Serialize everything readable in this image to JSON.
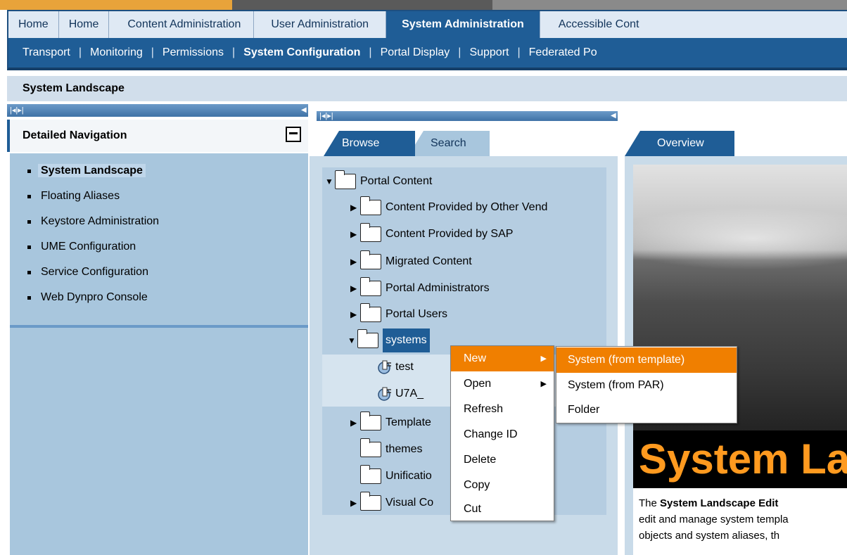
{
  "top_nav": {
    "tabs": [
      {
        "label": "Home"
      },
      {
        "label": "Home"
      },
      {
        "label": "Content Administration"
      },
      {
        "label": "User Administration"
      },
      {
        "label": "System Administration",
        "active": true
      },
      {
        "label": "Accessible Cont"
      }
    ]
  },
  "sub_nav": {
    "items": [
      "Transport",
      "Monitoring",
      "Permissions",
      "System Configuration",
      "Portal Display",
      "Support",
      "Federated Po"
    ],
    "active": "System Configuration",
    "separator": "|"
  },
  "page_title": "System Landscape",
  "left_nav": {
    "title": "Detailed Navigation",
    "items": [
      {
        "label": "System Landscape",
        "active": true
      },
      {
        "label": "Floating Aliases"
      },
      {
        "label": "Keystore Administration"
      },
      {
        "label": "UME Configuration"
      },
      {
        "label": "Service Configuration"
      },
      {
        "label": "Web Dynpro Console"
      }
    ]
  },
  "browse_tabs": {
    "browse": "Browse",
    "search": "Search"
  },
  "tree": {
    "root": "Portal Content",
    "children": [
      "Content Provided by Other Vend",
      "Content Provided by SAP",
      "Migrated Content",
      "Portal Administrators",
      "Portal Users",
      "systems",
      "Template",
      "themes",
      "Unificatio",
      "Visual Co"
    ],
    "system_children": [
      "test",
      "U7A_"
    ]
  },
  "context_menu": {
    "items": [
      "New",
      "Open",
      "Refresh",
      "Change ID",
      "Delete",
      "Copy",
      "Cut"
    ],
    "highlighted": "New",
    "submenu": [
      "System (from template)",
      "System (from PAR)",
      "Folder"
    ],
    "submenu_highlighted": "System (from template)"
  },
  "overview": {
    "tab": "Overview",
    "hero_text": "System La",
    "desc_line1_pre": "The ",
    "desc_line1_bold": "System Landscape Edit",
    "desc_line2": "edit and manage system templa",
    "desc_line3": "objects and system aliases, th"
  },
  "colors": {
    "nav_blue": "#1f5d96",
    "panel_blue": "#a8c6dd",
    "menu_highlight": "#f07f00",
    "hero_text": "#ff9a1f"
  }
}
